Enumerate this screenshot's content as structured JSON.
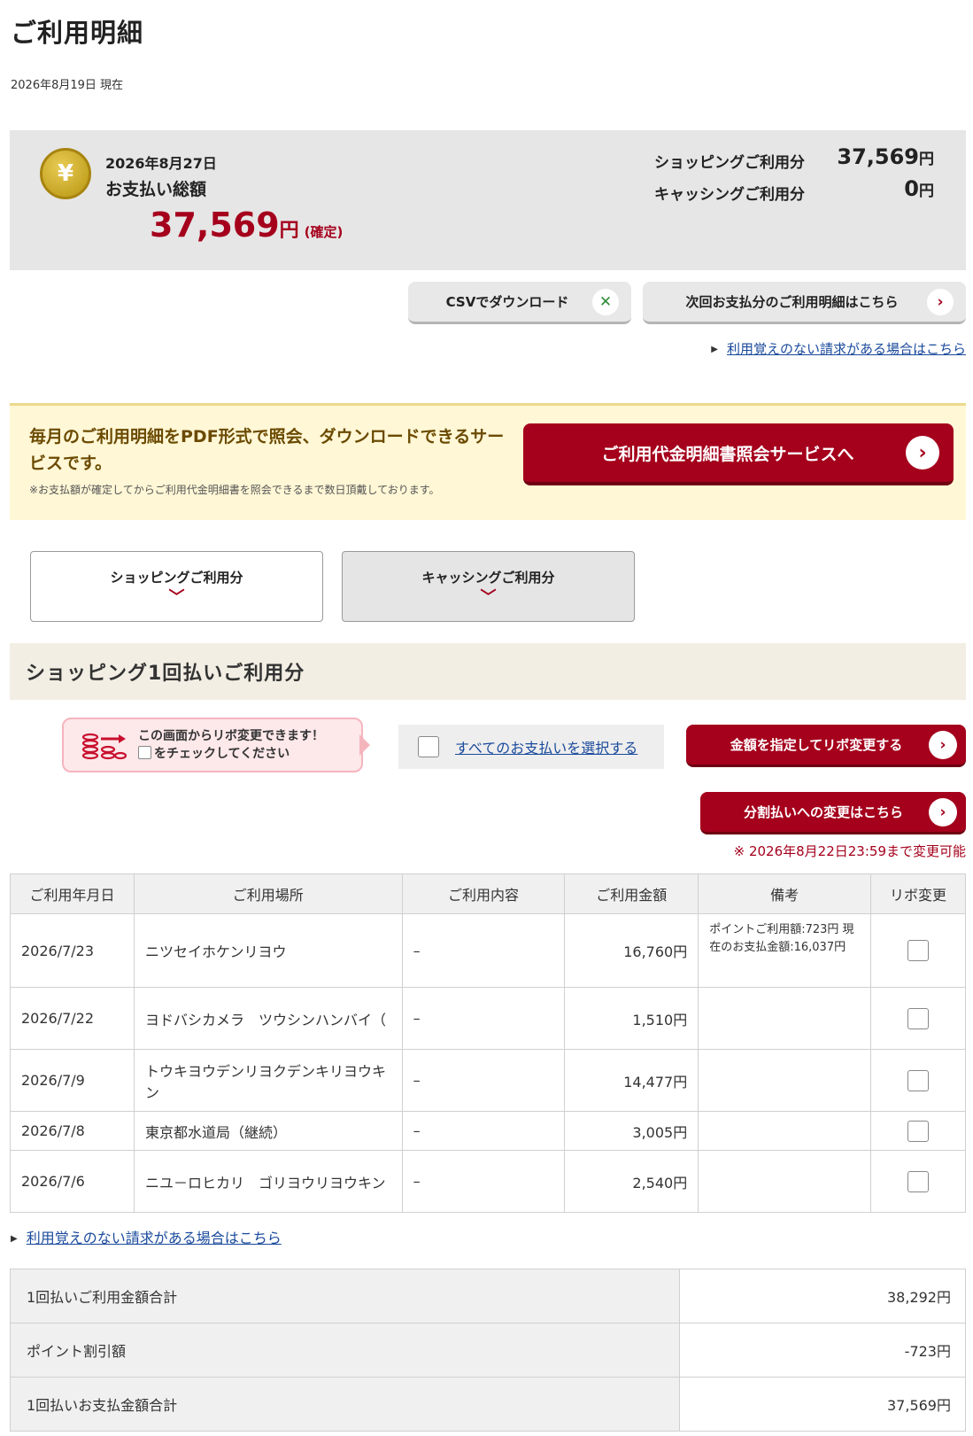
{
  "header": {
    "title": "ご利用明細",
    "as_of": "2026年8月19日 現在"
  },
  "summary": {
    "coin_symbol": "¥",
    "payment_date": "2026年8月27日",
    "payment_label": "お支払い総額",
    "total_amount": "37,569",
    "unit": "円",
    "status": "(確定)",
    "shopping_label": "ショッピングご利用分",
    "shopping_value": "37,569",
    "cashing_label": "キャッシングご利用分",
    "cashing_value": "0"
  },
  "actions": {
    "csv_label": "CSVでダウンロード",
    "next_label": "次回お支払分のご利用明細はこちら",
    "unknown_charge_link": "利用覚えのない請求がある場合はこちら"
  },
  "banner": {
    "text": "毎月のご利用明細をPDF形式で照会、ダウンロードできるサービスです。",
    "note": "※お支払額が確定してからご利用代金明細書を照会できるまで数日頂戴しております。",
    "button_label": "ご利用代金明細書照会サービスへ"
  },
  "tabs": [
    {
      "label": "ショッピングご利用分"
    },
    {
      "label": "キャッシングご利用分"
    }
  ],
  "section": {
    "title": "ショッピング1回払いご利用分",
    "notice_line1": "この画面からリボ変更できます！",
    "notice_line2": "をチェックしてください",
    "select_all_label": "すべてのお支払いを選択する",
    "revo_button": "金額を指定してリボ変更する",
    "split_button": "分割払いへの変更はこちら",
    "deadline": "※ 2026年8月22日23:59まで変更可能"
  },
  "table": {
    "headers": [
      "ご利用年月日",
      "ご利用場所",
      "ご利用内容",
      "ご利用金額",
      "備考",
      "リボ変更"
    ],
    "rows": [
      {
        "date": "2026/7/23",
        "place": "ニツセイホケンリヨウ",
        "content": "–",
        "amount": "16,760円",
        "note": "ポイントご利用額:723円 現在のお支払金額:16,037円"
      },
      {
        "date": "2026/7/22",
        "place": "ヨドバシカメラ　ツウシンハンバイ（",
        "content": "–",
        "amount": "1,510円",
        "note": ""
      },
      {
        "date": "2026/7/9",
        "place": "トウキヨウデンリヨクデンキリヨウキン",
        "content": "–",
        "amount": "14,477円",
        "note": ""
      },
      {
        "date": "2026/7/8",
        "place": "東京都水道局（継続）",
        "content": "–",
        "amount": "3,005円",
        "note": ""
      },
      {
        "date": "2026/7/6",
        "place": "ニユ－ロヒカリ　ゴリヨウリヨウキン",
        "content": "–",
        "amount": "2,540円",
        "note": ""
      }
    ]
  },
  "bottom_link": "利用覚えのない請求がある場合はこちら",
  "totals": [
    {
      "label": "1回払いご利用金額合計",
      "value": "38,292円"
    },
    {
      "label": "ポイント割引額",
      "value": "-723円"
    },
    {
      "label": "1回払いお支払金額合計",
      "value": "37,569円"
    }
  ]
}
